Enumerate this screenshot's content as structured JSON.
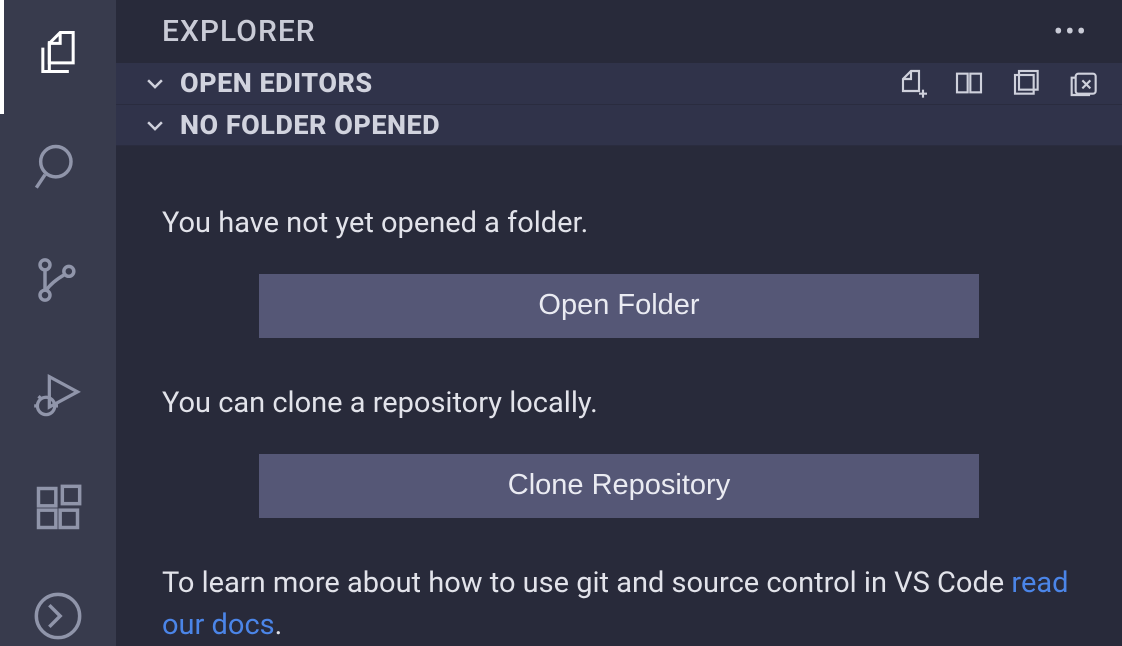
{
  "sidebar_title": "EXPLORER",
  "sections": {
    "open_editors": {
      "label": "OPEN EDITORS"
    },
    "no_folder": {
      "label": "NO FOLDER OPENED"
    }
  },
  "welcome": {
    "line1": "You have not yet opened a folder.",
    "open_folder_btn": "Open Folder",
    "line2": "You can clone a repository locally.",
    "clone_btn": "Clone Repository",
    "line3_prefix": "To learn more about how to use git and source control in VS Code ",
    "line3_link": "read our docs",
    "line3_suffix": "."
  }
}
